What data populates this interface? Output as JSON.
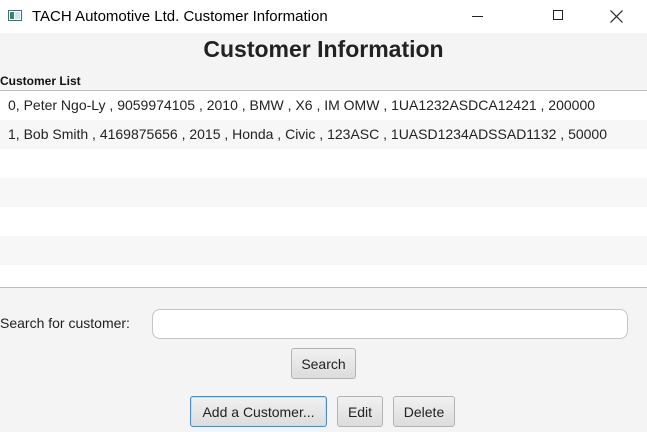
{
  "window": {
    "title": "TACH Automotive Ltd. Customer Information"
  },
  "main": {
    "heading": "Customer Information",
    "list_label": "Customer List",
    "customers": [
      "0, Peter Ngo-Ly , 9059974105 , 2010 , BMW , X6 , IM OMW , 1UA1232ASDCA12421 , 200000",
      "1, Bob Smith , 4169875656 , 2015 , Honda , Civic , 123ASC , 1UASD1234ADSSAD1132 , 50000"
    ]
  },
  "search": {
    "label": "Search for customer:",
    "value": "",
    "button_label": "Search"
  },
  "actions": {
    "add_label": "Add a Customer...",
    "edit_label": "Edit",
    "delete_label": "Delete"
  },
  "icons": {
    "app": "java-app-icon",
    "minimize": "minimize-icon",
    "maximize": "maximize-icon",
    "close": "close-icon"
  }
}
